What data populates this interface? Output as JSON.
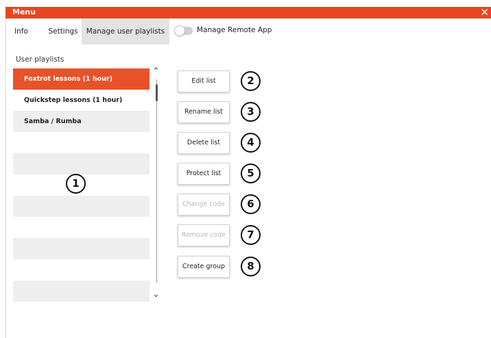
{
  "window": {
    "title": "Menu",
    "close_glyph": "✕"
  },
  "tabs": [
    {
      "label": "Info"
    },
    {
      "label": "Settings"
    },
    {
      "label": "Manage user playlists",
      "active": true
    }
  ],
  "remote_toggle": {
    "label": "Manage Remote App",
    "on": false
  },
  "playlists": {
    "heading": "User playlists",
    "items": [
      {
        "label": "Foxtrot lessons (1 hour)",
        "selected": true
      },
      {
        "label": "Quickstep lessons (1 hour)"
      },
      {
        "label": "Samba / Rumba"
      },
      {
        "label": ""
      },
      {
        "label": ""
      },
      {
        "label": ""
      },
      {
        "label": ""
      },
      {
        "label": ""
      },
      {
        "label": ""
      },
      {
        "label": ""
      },
      {
        "label": ""
      }
    ],
    "scroll_up": "⌃",
    "scroll_down": "⌄"
  },
  "actions": [
    {
      "label": "Edit list",
      "enabled": true,
      "callout": "2"
    },
    {
      "label": "Rename list",
      "enabled": true,
      "callout": "3"
    },
    {
      "label": "Delete list",
      "enabled": true,
      "callout": "4"
    },
    {
      "label": "Protect list",
      "enabled": true,
      "callout": "5"
    },
    {
      "label": "Change code",
      "enabled": false,
      "callout": "6"
    },
    {
      "label": "Remove code",
      "enabled": false,
      "callout": "7"
    },
    {
      "label": "Create group",
      "enabled": true,
      "callout": "8"
    }
  ],
  "list_callout": "1",
  "colors": {
    "accent": "#e8461f",
    "selected_row": "#e8522a",
    "row_shade": "#eeeeee"
  }
}
